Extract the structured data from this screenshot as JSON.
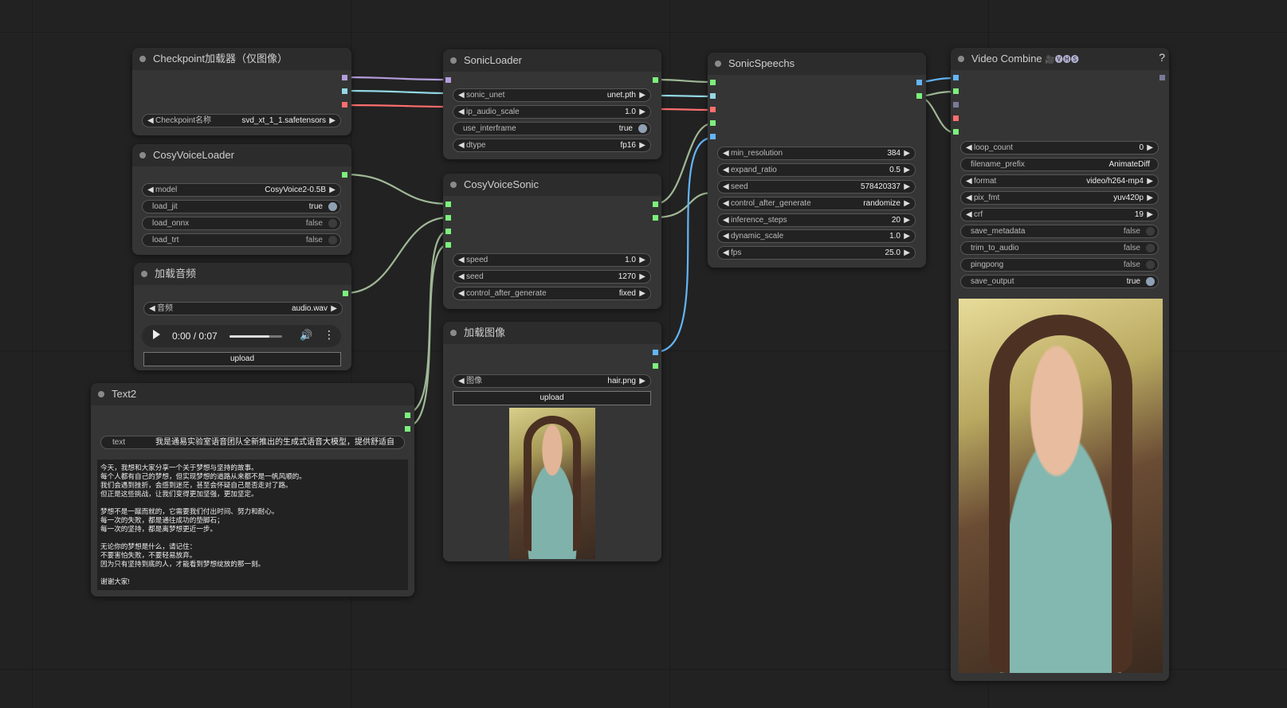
{
  "colors": {
    "canvas": "#222222",
    "node_bg": "#353535",
    "link_model": "#b39ddb",
    "link_clip": "#93d8e4",
    "link_vae": "#ff6e6e",
    "link_generic": "#a0b896",
    "link_image": "#64b5f6",
    "slot_green": "#7cf07c",
    "slot_blue": "#64b5f6"
  },
  "nodes": {
    "checkpoint": {
      "title": "Checkpoint加载器（仅图像）",
      "ckpt_label": "Checkpoint名称",
      "ckpt_value": "svd_xt_1_1.safetensors"
    },
    "cosyloader": {
      "title": "CosyVoiceLoader",
      "model_label": "model",
      "model_value": "CosyVoice2-0.5B",
      "load_jit_label": "load_jit",
      "load_jit_value": "true",
      "load_onnx_label": "load_onnx",
      "load_onnx_value": "false",
      "load_trt_label": "load_trt",
      "load_trt_value": "false"
    },
    "audio": {
      "title": "加载音频",
      "audio_label": "音频",
      "audio_value": "audio.wav",
      "time": "0:00 / 0:07",
      "progress": 0.75,
      "upload": "upload",
      "play_icon": "play-icon",
      "volume_icon": "volume-icon",
      "more_icon": "more-vert-icon"
    },
    "text2": {
      "title": "Text2",
      "text_label": "text",
      "text_value": "我是通易实验室语音团队全新推出的生成式语音大模型，提供舒适自",
      "body": "今天，我想和大家分享一个关于梦想与坚持的故事。\n每个人都有自己的梦想，但实现梦想的道路从来都不是一帆风顺的。\n我们会遇到挫折，会感到迷茫，甚至会怀疑自己是否走对了路。\n但正是这些挑战，让我们变得更加坚强，更加坚定。\n\n梦想不是一蹴而就的，它需要我们付出时间、努力和耐心。\n每一次的失败，都是通往成功的垫脚石；\n每一次的坚持，都是离梦想更近一步。\n\n无论你的梦想是什么，请记住：\n不要害怕失败，不要轻易放弃。\n因为只有坚持到底的人，才能看到梦想绽放的那一刻。\n\n谢谢大家!"
    },
    "sonicloader": {
      "title": "SonicLoader",
      "unet_label": "sonic_unet",
      "unet_value": "unet.pth",
      "scale_label": "ip_audio_scale",
      "scale_value": "1.0",
      "interframe_label": "use_interframe",
      "interframe_value": "true",
      "dtype_label": "dtype",
      "dtype_value": "fp16"
    },
    "cosysonic": {
      "title": "CosyVoiceSonic",
      "speed_label": "speed",
      "speed_value": "1.0",
      "seed_label": "seed",
      "seed_value": "1270",
      "cag_label": "control_after_generate",
      "cag_value": "fixed"
    },
    "loadimage": {
      "title": "加载图像",
      "image_label": "图像",
      "image_value": "hair.png",
      "upload": "upload"
    },
    "speech": {
      "title": "SonicSpeechs",
      "minres_label": "min_resolution",
      "minres_value": "384",
      "expand_label": "expand_ratio",
      "expand_value": "0.5",
      "seed_label": "seed",
      "seed_value": "578420337",
      "cag_label": "control_after_generate",
      "cag_value": "randomize",
      "steps_label": "inference_steps",
      "steps_value": "20",
      "dyn_label": "dynamic_scale",
      "dyn_value": "1.0",
      "fps_label": "fps",
      "fps_value": "25.0"
    },
    "videocombine": {
      "title": "Video Combine",
      "title_icons": "🎥🅥🅗🅢",
      "help": "?",
      "loop_label": "loop_count",
      "loop_value": "0",
      "prefix_label": "filename_prefix",
      "prefix_value": "AnimateDiff",
      "format_label": "format",
      "format_value": "video/h264-mp4",
      "pixfmt_label": "pix_fmt",
      "pixfmt_value": "yuv420p",
      "crf_label": "crf",
      "crf_value": "19",
      "savemeta_label": "save_metadata",
      "savemeta_value": "false",
      "trim_label": "trim_to_audio",
      "trim_value": "false",
      "ping_label": "pingpong",
      "ping_value": "false",
      "saveout_label": "save_output",
      "saveout_value": "true"
    }
  }
}
